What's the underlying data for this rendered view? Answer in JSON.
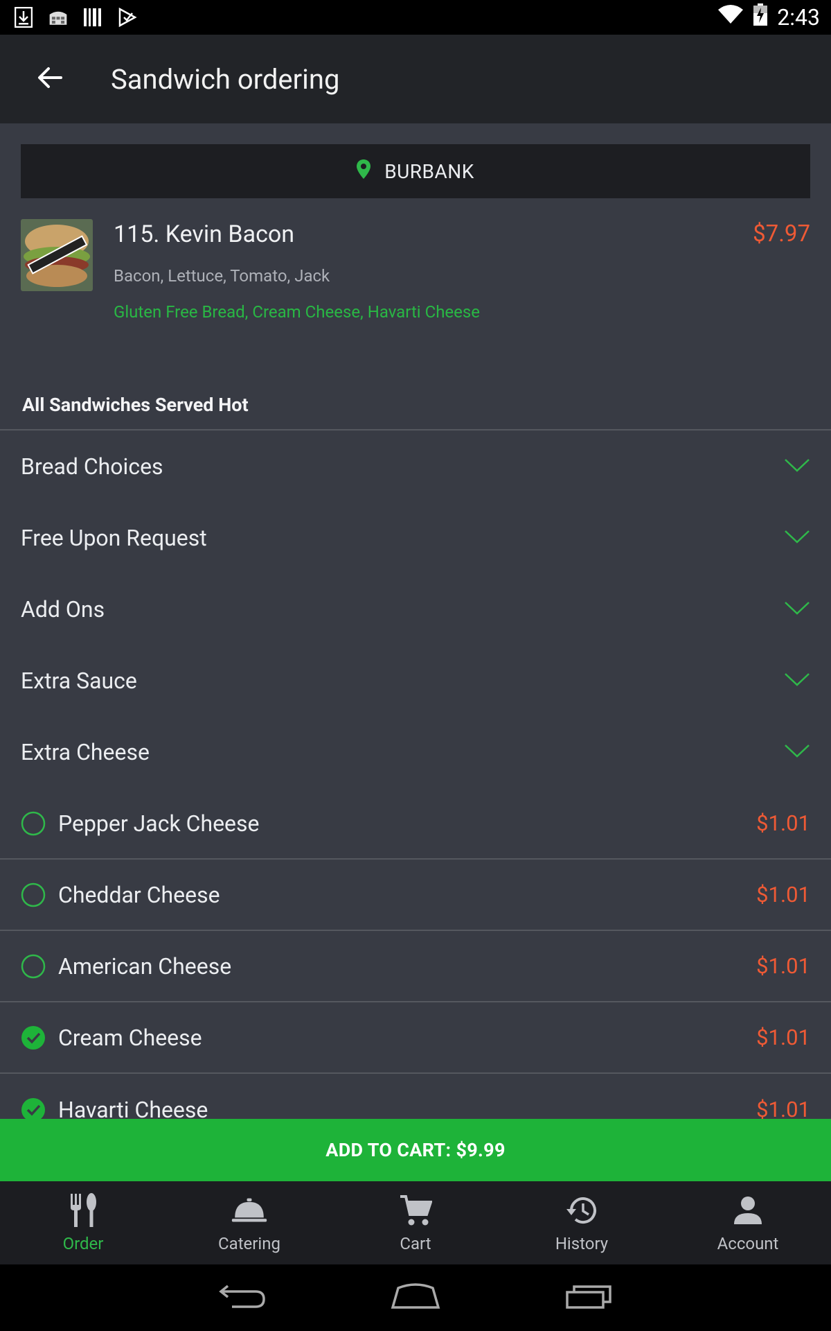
{
  "status_bar": {
    "time": "2:43",
    "left_icons": [
      "download-icon",
      "store-icon",
      "barcode-icon",
      "play-store-icon"
    ],
    "right_icons": [
      "wifi-icon",
      "battery-charging-icon"
    ]
  },
  "toolbar": {
    "title": "Sandwich ordering",
    "back_icon": "arrow-back-icon"
  },
  "location": {
    "icon": "map-pin-icon",
    "name": "BURBANK"
  },
  "product": {
    "name": "115. Kevin Bacon",
    "price": "$7.97",
    "description": "Bacon, Lettuce, Tomato, Jack",
    "selected_options": "Gluten Free Bread, Cream Cheese, Havarti Cheese"
  },
  "section_header": "All Sandwiches Served Hot",
  "accordion": [
    {
      "label": "Bread Choices"
    },
    {
      "label": "Free Upon Request"
    },
    {
      "label": "Add Ons"
    },
    {
      "label": "Extra Sauce"
    },
    {
      "label": "Extra Cheese"
    }
  ],
  "options": [
    {
      "label": "Pepper Jack Cheese",
      "price": "$1.01",
      "checked": false
    },
    {
      "label": "Cheddar Cheese",
      "price": "$1.01",
      "checked": false
    },
    {
      "label": "American Cheese",
      "price": "$1.01",
      "checked": false
    },
    {
      "label": "Cream Cheese",
      "price": "$1.01",
      "checked": true
    },
    {
      "label": "Havarti Cheese",
      "price": "$1.01",
      "checked": true
    }
  ],
  "add_to_cart": "ADD TO CART: $9.99",
  "bottom_nav": [
    {
      "label": "Order",
      "icon": "fork-knife-icon",
      "active": true
    },
    {
      "label": "Catering",
      "icon": "serving-bell-icon",
      "active": false
    },
    {
      "label": "Cart",
      "icon": "cart-icon",
      "active": false
    },
    {
      "label": "History",
      "icon": "history-icon",
      "active": false
    },
    {
      "label": "Account",
      "icon": "person-icon",
      "active": false
    }
  ],
  "colors": {
    "accent_green": "#1eb339",
    "price_orange": "#ef5a35",
    "background": "#383b44",
    "toolbar": "#222428"
  }
}
